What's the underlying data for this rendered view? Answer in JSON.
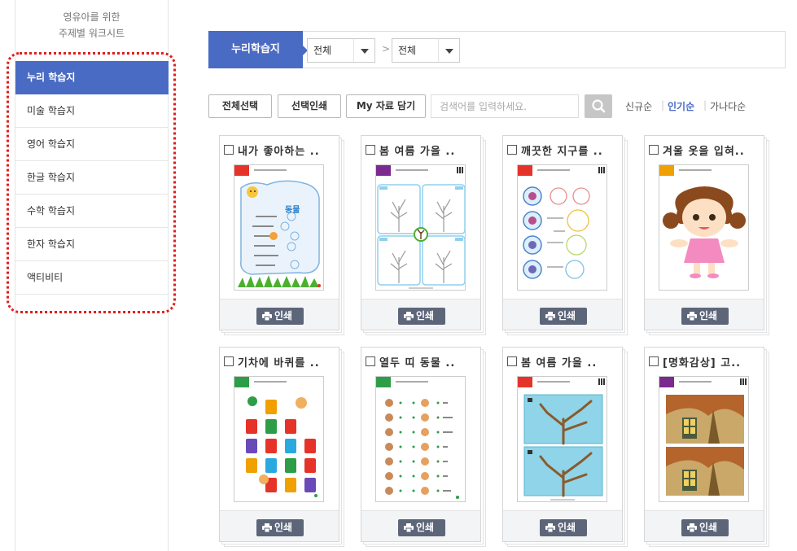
{
  "sidebar": {
    "title_line1": "영유아를 위한",
    "title_line2": "주제별 워크시트",
    "items": [
      {
        "label": "누리 학습지"
      },
      {
        "label": "미술 학습지"
      },
      {
        "label": "영어 학습지"
      },
      {
        "label": "한글 학습지"
      },
      {
        "label": "수학 학습지"
      },
      {
        "label": "한자 학습지"
      },
      {
        "label": "액티비티"
      }
    ]
  },
  "topbar": {
    "title": "누리학습지",
    "select1": "전체",
    "select2": "전체",
    "separator": ">"
  },
  "toolbar": {
    "select_all": "전체선택",
    "print_selected": "선택인쇄",
    "my_save": "My 자료 담기",
    "search_placeholder": "검색어를 입력하세요.",
    "sort_new": "신규순",
    "sort_popular": "인기순",
    "sort_alpha": "가나다순"
  },
  "cards": [
    {
      "title": "내가 좋아하는 ..",
      "tab_color": "#e63329",
      "print": "인쇄"
    },
    {
      "title": "봄 여름 가을 ..",
      "tab_color": "#7b2a8f",
      "print": "인쇄"
    },
    {
      "title": "깨끗한 지구를 ..",
      "tab_color": "#e63329",
      "print": "인쇄"
    },
    {
      "title": "겨울 옷을 입혀..",
      "tab_color": "#f0a000",
      "print": "인쇄"
    },
    {
      "title": "기차에 바퀴를 ..",
      "tab_color": "#2e9d48",
      "print": "인쇄"
    },
    {
      "title": "열두 띠 동물 ..",
      "tab_color": "#2e9d48",
      "print": "인쇄"
    },
    {
      "title": "봄 여름 가을 ..",
      "tab_color": "#e63329",
      "print": "인쇄"
    },
    {
      "title": "[명화감상] 고..",
      "tab_color": "#7b2a8f",
      "print": "인쇄"
    }
  ],
  "thumb_texts": {
    "animals_heading": "동물"
  },
  "colors": {
    "accent": "#4a6bc3",
    "print_button": "#5d6679",
    "highlight_border": "#e21c1c"
  }
}
